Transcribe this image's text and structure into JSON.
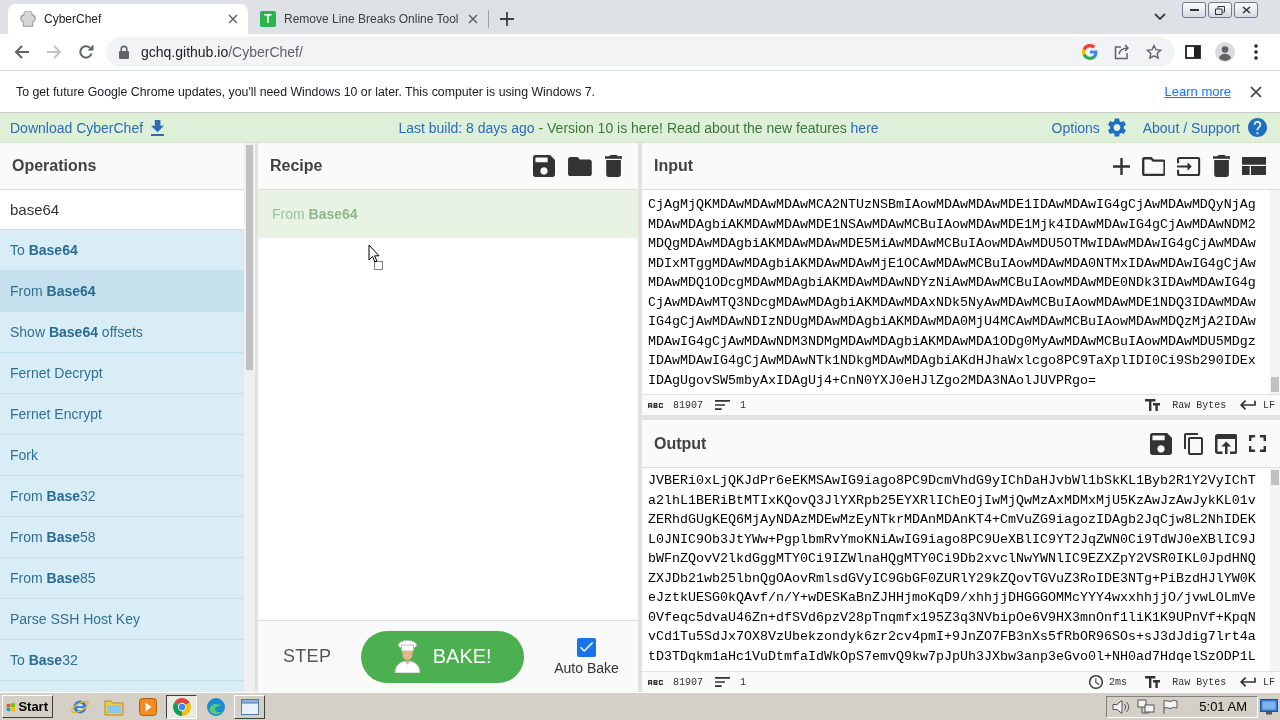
{
  "browser": {
    "tabs": [
      {
        "title": "CyberChef",
        "selected": true,
        "kind": "chef"
      },
      {
        "title": "Remove Line Breaks Online Tool",
        "selected": false,
        "kind": "letter",
        "logo": "T"
      }
    ],
    "address": {
      "host": "gchq.github.io",
      "path": "/CyberChef/"
    }
  },
  "infobar": {
    "message": "To get future Google Chrome updates, you'll need Windows 10 or later. This computer is using Windows 7.",
    "link": "Learn more"
  },
  "banner": {
    "download": "Download CyberChef",
    "build_info": "Last build: 8 days ago",
    "notice": "- Version 10 is here! Read about the new features",
    "notice_link": "here",
    "options": "Options",
    "about": "About / Support"
  },
  "operations": {
    "title": "Operations",
    "search": {
      "value": "base64"
    },
    "items": [
      {
        "label": "To **Base64**",
        "selected": false
      },
      {
        "label": "From **Base64**",
        "selected": true
      },
      {
        "label": "Show **Base64** offsets",
        "selected": false
      },
      {
        "label": "Fernet Decrypt",
        "selected": false
      },
      {
        "label": "Fernet Encrypt",
        "selected": false
      },
      {
        "label": "Fork",
        "selected": false
      },
      {
        "label": "From **Base**32",
        "selected": false
      },
      {
        "label": "From **Base**58",
        "selected": false
      },
      {
        "label": "From **Base**85",
        "selected": false
      },
      {
        "label": "Parse SSH Host Key",
        "selected": false
      },
      {
        "label": "To **Base**32",
        "selected": false
      }
    ]
  },
  "recipe": {
    "title": "Recipe",
    "items": [
      {
        "label": "From **Base64**"
      }
    ],
    "step": "STEP",
    "bake": "BAKE!",
    "auto_bake": {
      "label": "Auto Bake",
      "checked": true
    }
  },
  "input": {
    "title": "Input",
    "lines": [
      "CjAgMjQKMDAwMDAwMDAwMCA2NTUzNSBmIAowMDAwMDAwMDE1IDAwMDAwIG4gCjAwMDAwMDQyNjAg",
      "MDAwMDAgbiAKMDAwMDAwMDE1NSAwMDAwMCBuIAowMDAwMDE1Mjk4IDAwMDAwIG4gCjAwMDAwNDM2",
      "MDQgMDAwMDAgbiAKMDAwMDAwMDE5MiAwMDAwMCBuIAowMDAwMDU5OTMwIDAwMDAwIG4gCjAwMDAw",
      "MDIxMTggMDAwMDAgbiAKMDAwMDAwMjE1OCAwMDAwMCBuIAowMDAwMDA0NTMxIDAwMDAwIG4gCjAw",
      "MDAwMDQ1ODcgMDAwMDAgbiAKMDAwMDAwNDYzNiAwMDAwMCBuIAowMDAwMDE0NDk3IDAwMDAwIG4g",
      "CjAwMDAwMTQ3NDcgMDAwMDAgbiAKMDAwMDAxNDk5NyAwMDAwMCBuIAowMDAwMDE1NDQ3IDAwMDAw",
      "IG4gCjAwMDAwNDIzNDUgMDAwMDAgbiAKMDAwMDA0MjU4MCAwMDAwMCBuIAowMDAwMDQzMjA2IDAw",
      "MDAwIG4gCjAwMDAwNDM3NDMgMDAwMDAgbiAKMDAwMDA1ODg0MyAwMDAwMCBuIAowMDAwMDU5MDgz",
      "IDAwMDAwIG4gCjAwMDAwNTk1NDkgMDAwMDAgbiAKdHJhaWxlcgo8PC9TaXplIDI0Ci9Sb290IDEx",
      "IDAgUgovSW5mbyAxIDAgUj4+CnN0YXJ0eHJlZgo2MDA3NAolJUVPRgo="
    ],
    "length": "81907",
    "line_count": "1",
    "format": "Raw Bytes",
    "eol": "LF"
  },
  "output": {
    "title": "Output",
    "lines": [
      "JVBERi0xLjQKJdPr6eEKMSAwIG9iago8PC9DcmVhdG9yIChDaHJvbWl1bSkKL1Byb2R1Y2VyIChT",
      "a2lhL1BERiBtMTIxKQovQ3JlYXRpb25EYXRlIChEOjIwMjQwMzAxMDMxMjU5KzAwJzAwJykKL01v",
      "ZERhdGUgKEQ6MjAyNDAzMDEwMzEyNTkrMDAnMDAnKT4+CmVuZG9iagozIDAgb2JqCjw8L2NhIDEK",
      "L0JNIC9Ob3JtYWw+PgplbmRvYmoKNiAwIG9iago8PC9UeXBlIC9YT2JqZWN0Ci9TdWJ0eXBlIC9J",
      "bWFnZQovV2lkdGggMTY0Ci9IZWlnaHQgMTY0Ci9Db2xvclNwYWNlIC9EZXZpY2VSR0IKL0JpdHNQ",
      "ZXJDb21wb25lbnQgOAovRmlsdGVyIC9GbGF0ZURlY29kZQovTGVuZ3RoIDE3NTg+PiBzdHJlYW0K",
      "eJztkUESG0kQAvf/n/Y+wDESKaBnZJHHjmoKqD9/xhhjjDHGGGOMMcYYY4wxxhhjjO/jvwLOLmVe",
      "0Vfeqc5dvaU46Zn+dfSVd6pzV28pTnqmfx195Z3q3NVbipOe6V9HX3mnOnf1liK1K9UPnVf+KpqN",
      "vCd1Tu5SdJx7OX8VzUbekzondyk6zr2cv4pmI+9JnZO7FB3nXs5fRbOR96SOs+sJ3dJdig7lrt4a",
      "tD3TDqkm1aHc1VuDtmfaIdWkOpS7emvQ9kw7pJpUh3JXbw3anp3eGvo0l+NH0ad7HdqelSzODP1L"
    ],
    "length": "81907",
    "line_count": "1",
    "time": "2ms",
    "format": "Raw Bytes",
    "eol": "LF"
  },
  "taskbar": {
    "start": "Start",
    "items": [
      {
        "kind": "ie",
        "selected": false,
        "open": false
      },
      {
        "kind": "folder",
        "selected": false,
        "open": false
      },
      {
        "kind": "player",
        "selected": false,
        "open": false
      },
      {
        "kind": "chrome",
        "selected": true,
        "open": true
      },
      {
        "kind": "edge",
        "selected": false,
        "open": false
      },
      {
        "kind": "notepad",
        "selected": false,
        "open": true
      }
    ],
    "clock": "5:01 AM"
  }
}
